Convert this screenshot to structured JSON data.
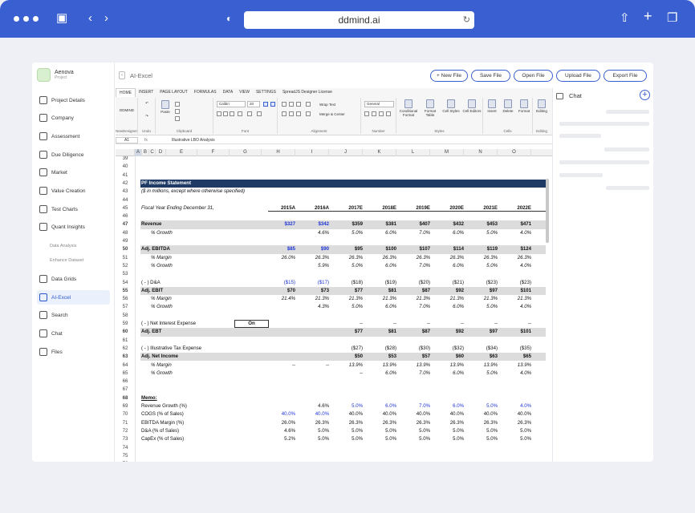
{
  "browser": {
    "url": "ddmind.ai"
  },
  "brand": {
    "name": "Aenova",
    "subtitle": "Project"
  },
  "sidebar": {
    "items": [
      {
        "label": "Project Details",
        "icon": "clipboard-icon"
      },
      {
        "label": "Company",
        "icon": "building-icon"
      },
      {
        "label": "Assessment",
        "icon": "share-icon"
      },
      {
        "label": "Due Diligence",
        "icon": "search-doc-icon"
      },
      {
        "label": "Market",
        "icon": "globe-icon"
      },
      {
        "label": "Value Creation",
        "icon": "check-circle-icon"
      },
      {
        "label": "Test Charts",
        "icon": "bell-icon"
      },
      {
        "label": "Quant Insights",
        "icon": "bulb-icon"
      },
      {
        "label": "Data Analysis",
        "icon": ""
      },
      {
        "label": "Enhance Dataset",
        "icon": ""
      },
      {
        "label": "Data Grids",
        "icon": "grid-icon"
      },
      {
        "label": "AI-Excel",
        "icon": "excel-icon",
        "active": true
      },
      {
        "label": "Search",
        "icon": "search-icon"
      },
      {
        "label": "Chat",
        "icon": "chat-icon"
      },
      {
        "label": "Files",
        "icon": "files-icon"
      }
    ]
  },
  "header": {
    "title": "AI-Excel",
    "buttons": [
      "+ New File",
      "Save File",
      "Open File",
      "Upload File",
      "Export File"
    ]
  },
  "chat": {
    "title": "Chat",
    "plus": "+"
  },
  "ribbon": {
    "tabs": [
      "HOME",
      "INSERT",
      "PAGE LAYOUT",
      "FORMULAS",
      "DATA",
      "VIEW",
      "SETTINGS",
      "SpreadJS Designer License"
    ],
    "groups": [
      "NewDesigner",
      "Undo",
      "Clipboard",
      "Font",
      "Alignment",
      "Number",
      "Styles",
      "Cells",
      "Editing"
    ],
    "new_btn": "DDMIND",
    "paste": "Paste",
    "font_name": "Calibri",
    "font_size": "20",
    "wrap_text": "Wrap Text",
    "merge_center": "Merge & Center",
    "number_format": "General",
    "conditional_format": "Conditional Format",
    "format_table": "Format Table",
    "cell_styles": "Cell Styles",
    "cell_editors": "Cell Editors",
    "insert": "Insert",
    "delete": "Delete",
    "format": "Format",
    "editing": "Editing"
  },
  "formula_bar": {
    "cell": "A1",
    "fx": "fx",
    "value": "Illustrative LBO Analysis"
  },
  "columns": [
    "A",
    "B",
    "C",
    "D",
    "E",
    "F",
    "G",
    "H",
    "I",
    "J",
    "K",
    "L",
    "M",
    "N",
    "O"
  ],
  "sheet": {
    "rows": [
      {
        "n": "39",
        "label": "",
        "vals": []
      },
      {
        "n": "40",
        "label": "",
        "vals": []
      },
      {
        "n": "41",
        "label": "",
        "vals": []
      },
      {
        "n": "42",
        "label": "PF Income Statement",
        "style": "titlebar",
        "vals": []
      },
      {
        "n": "43",
        "label": "($ in millions, except where otherwise specified)",
        "style": "ital",
        "vals": []
      },
      {
        "n": "44",
        "label": "",
        "vals": []
      },
      {
        "n": "45",
        "label": "Fiscal Year Ending December 31,",
        "style": "ital hdr",
        "vals": [
          "2015A",
          "2016A",
          "2017E",
          "2018E",
          "2019E",
          "2020E",
          "2021E",
          "2022E"
        ]
      },
      {
        "n": "46",
        "label": "",
        "vals": []
      },
      {
        "n": "47",
        "label": "Revenue",
        "style": "shade bold",
        "vals": [
          "$327",
          "$342",
          "$359",
          "$381",
          "$407",
          "$432",
          "$453",
          "$471"
        ],
        "blue": [
          0,
          1
        ]
      },
      {
        "n": "48",
        "label": "% Growth",
        "style": "ital indent",
        "vals": [
          "",
          "4.6%",
          "5.0%",
          "6.0%",
          "7.0%",
          "6.0%",
          "5.0%",
          "4.0%"
        ]
      },
      {
        "n": "49",
        "label": "",
        "vals": []
      },
      {
        "n": "50",
        "label": "Adj. EBITDA",
        "style": "shade bold",
        "vals": [
          "$85",
          "$90",
          "$95",
          "$100",
          "$107",
          "$114",
          "$119",
          "$124"
        ],
        "blue": [
          0,
          1
        ]
      },
      {
        "n": "51",
        "label": "% Margin",
        "style": "ital indent",
        "vals": [
          "26.0%",
          "26.3%",
          "26.3%",
          "26.3%",
          "26.3%",
          "26.3%",
          "26.3%",
          "26.3%"
        ]
      },
      {
        "n": "52",
        "label": "% Growth",
        "style": "ital indent",
        "vals": [
          "",
          "5.9%",
          "5.0%",
          "6.0%",
          "7.0%",
          "6.0%",
          "5.0%",
          "4.0%"
        ]
      },
      {
        "n": "53",
        "label": "",
        "vals": []
      },
      {
        "n": "54",
        "label": "( - ) D&A",
        "vals": [
          "($15)",
          "($17)",
          "($18)",
          "($19)",
          "($20)",
          "($21)",
          "($23)",
          "($23)"
        ],
        "blue": [
          0,
          1
        ]
      },
      {
        "n": "55",
        "label": "Adj. EBIT",
        "style": "shade bold",
        "vals": [
          "$70",
          "$73",
          "$77",
          "$81",
          "$87",
          "$92",
          "$97",
          "$101"
        ]
      },
      {
        "n": "56",
        "label": "% Margin",
        "style": "ital indent",
        "vals": [
          "21.4%",
          "21.3%",
          "21.3%",
          "21.3%",
          "21.3%",
          "21.3%",
          "21.3%",
          "21.3%"
        ]
      },
      {
        "n": "57",
        "label": "% Growth",
        "style": "ital indent",
        "vals": [
          "",
          "4.3%",
          "5.0%",
          "6.0%",
          "7.0%",
          "6.0%",
          "5.0%",
          "4.0%"
        ]
      },
      {
        "n": "58",
        "label": "",
        "vals": []
      },
      {
        "n": "59",
        "label": "( - ) Net Interest Expense",
        "toggle": "On",
        "vals": [
          "",
          "",
          "--",
          "--",
          "--",
          "--",
          "--",
          "--"
        ]
      },
      {
        "n": "60",
        "label": "Adj. EBT",
        "style": "shade bold",
        "vals": [
          "",
          "",
          "$77",
          "$81",
          "$87",
          "$92",
          "$97",
          "$101"
        ]
      },
      {
        "n": "61",
        "label": "",
        "vals": []
      },
      {
        "n": "62",
        "label": "( - ) Illustrative Tax Expense",
        "vals": [
          "",
          "",
          "($27)",
          "($28)",
          "($30)",
          "($32)",
          "($34)",
          "($35)"
        ]
      },
      {
        "n": "63",
        "label": "Adj. Net Income",
        "style": "shade bold",
        "vals": [
          "",
          "",
          "$50",
          "$53",
          "$57",
          "$60",
          "$63",
          "$65"
        ]
      },
      {
        "n": "64",
        "label": "% Margin",
        "style": "ital indent",
        "vals": [
          "--",
          "--",
          "13.9%",
          "13.9%",
          "13.9%",
          "13.9%",
          "13.9%",
          "13.9%"
        ]
      },
      {
        "n": "65",
        "label": "% Growth",
        "style": "ital indent",
        "vals": [
          "",
          "",
          "--",
          "6.0%",
          "7.0%",
          "6.0%",
          "5.0%",
          "4.0%"
        ]
      },
      {
        "n": "66",
        "label": "",
        "vals": []
      },
      {
        "n": "67",
        "label": "",
        "vals": []
      },
      {
        "n": "68",
        "label": "Memo:",
        "style": "bold underline",
        "vals": []
      },
      {
        "n": "69",
        "label": "Revenue Growth (%)",
        "vals": [
          "",
          "4.6%",
          "5.0%",
          "6.0%",
          "7.0%",
          "6.0%",
          "5.0%",
          "4.0%"
        ],
        "blue": [
          2,
          3,
          4,
          5,
          6,
          7
        ]
      },
      {
        "n": "70",
        "label": "COGS (% of Sales)",
        "vals": [
          "40.0%",
          "40.0%",
          "40.0%",
          "40.0%",
          "40.0%",
          "40.0%",
          "40.0%",
          "40.0%"
        ],
        "blue": [
          0,
          1
        ]
      },
      {
        "n": "71",
        "label": "EBITDA Margin (%)",
        "vals": [
          "26.0%",
          "26.3%",
          "26.3%",
          "26.3%",
          "26.3%",
          "26.3%",
          "26.3%",
          "26.3%"
        ]
      },
      {
        "n": "72",
        "label": "D&A (% of Sales)",
        "vals": [
          "4.6%",
          "5.0%",
          "5.0%",
          "5.0%",
          "5.0%",
          "5.0%",
          "5.0%",
          "5.0%"
        ]
      },
      {
        "n": "73",
        "label": "CapEx (% of Sales)",
        "vals": [
          "5.2%",
          "5.0%",
          "5.0%",
          "5.0%",
          "5.0%",
          "5.0%",
          "5.0%",
          "5.0%"
        ]
      },
      {
        "n": "74",
        "label": "",
        "vals": []
      },
      {
        "n": "75",
        "label": "",
        "vals": []
      },
      {
        "n": "76",
        "label": "",
        "vals": []
      }
    ]
  },
  "colors": {
    "brand_blue": "#3a5fd0",
    "title_bar": "#1f3a64",
    "input_blue": "#1d33d6",
    "shade": "#dcdcdc"
  }
}
